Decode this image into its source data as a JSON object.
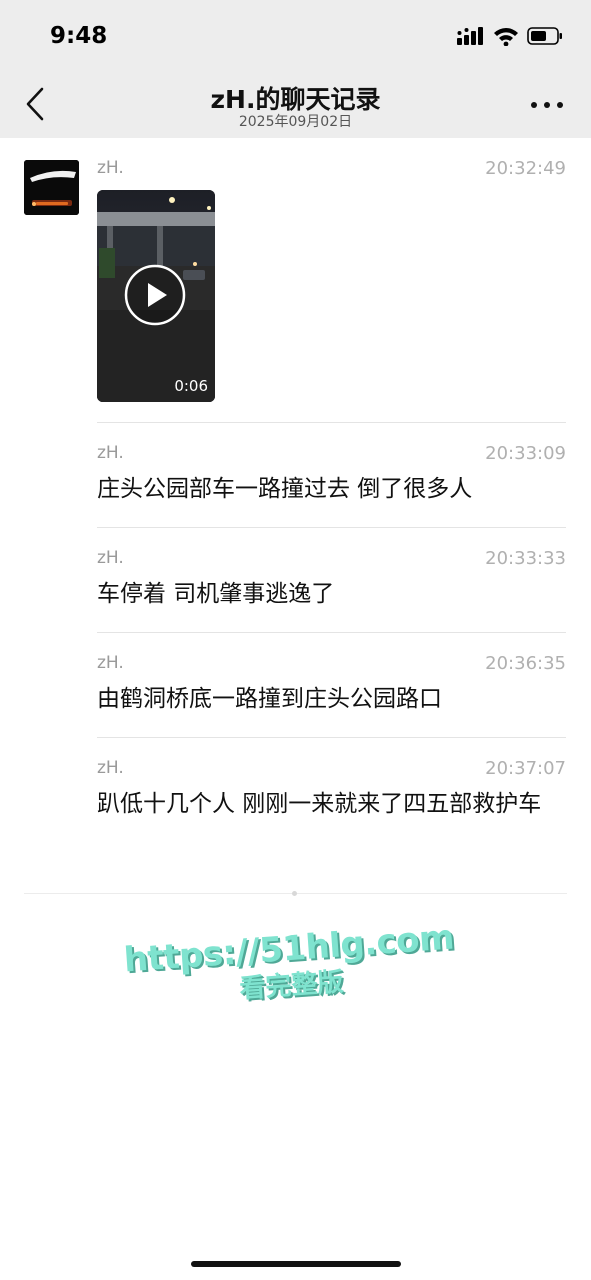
{
  "status_bar": {
    "time": "9:48"
  },
  "nav": {
    "title": "zH.的聊天记录",
    "subtitle": "2025年09月02日"
  },
  "video_message": {
    "sender": "zH.",
    "time": "20:32:49",
    "duration": "0:06"
  },
  "messages": [
    {
      "sender": "zH.",
      "time": "20:33:09",
      "text": "庄头公园部车一路撞过去  倒了很多人"
    },
    {
      "sender": "zH.",
      "time": "20:33:33",
      "text": "车停着   司机肇事逃逸了"
    },
    {
      "sender": "zH.",
      "time": "20:36:35",
      "text": "由鹤洞桥底一路撞到庄头公园路口"
    },
    {
      "sender": "zH.",
      "time": "20:37:07",
      "text": "趴低十几个人  刚刚一来就来了四五部救护车"
    }
  ],
  "watermark": {
    "url": "https://51hlg.com",
    "caption": "看完整版"
  },
  "colors": {
    "header_bg": "#ededed",
    "watermark": "#7fe3cf"
  }
}
